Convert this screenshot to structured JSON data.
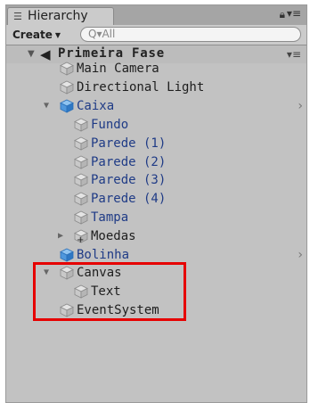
{
  "window": {
    "tab_title": "Hierarchy",
    "tab_icon": "list-icon",
    "lock_icon": "lock-icon",
    "menu_icon": "panel-menu-icon"
  },
  "toolbar": {
    "create_label": "Create",
    "search_placeholder": "Q▾All"
  },
  "scene": {
    "name": "Primeira Fase"
  },
  "items": [
    {
      "label": "Main Camera",
      "color": "black",
      "icon": "gameobject-icon"
    },
    {
      "label": "Directional Light",
      "color": "black",
      "icon": "gameobject-icon"
    },
    {
      "label": "Caixa",
      "color": "blue",
      "icon": "prefab-icon",
      "expanded": true
    },
    {
      "label": "Fundo",
      "color": "blue",
      "icon": "gameobject-icon"
    },
    {
      "label": "Parede (1)",
      "color": "blue",
      "icon": "gameobject-icon"
    },
    {
      "label": "Parede (2)",
      "color": "blue",
      "icon": "gameobject-icon"
    },
    {
      "label": "Parede (3)",
      "color": "blue",
      "icon": "gameobject-icon"
    },
    {
      "label": "Parede (4)",
      "color": "blue",
      "icon": "gameobject-icon"
    },
    {
      "label": "Tampa",
      "color": "blue",
      "icon": "gameobject-icon"
    },
    {
      "label": "Moedas",
      "color": "black",
      "icon": "prefab-add-icon",
      "expanded": false
    },
    {
      "label": "Bolinha",
      "color": "blue",
      "icon": "prefab-icon"
    },
    {
      "label": "Canvas",
      "color": "black",
      "icon": "gameobject-icon",
      "expanded": true
    },
    {
      "label": "Text",
      "color": "black",
      "icon": "gameobject-icon"
    },
    {
      "label": "EventSystem",
      "color": "black",
      "icon": "gameobject-icon"
    }
  ],
  "colors": {
    "panel_bg": "#c2c2c2",
    "prefab_text": "#1f3b86",
    "highlight_border": "#e60000"
  }
}
